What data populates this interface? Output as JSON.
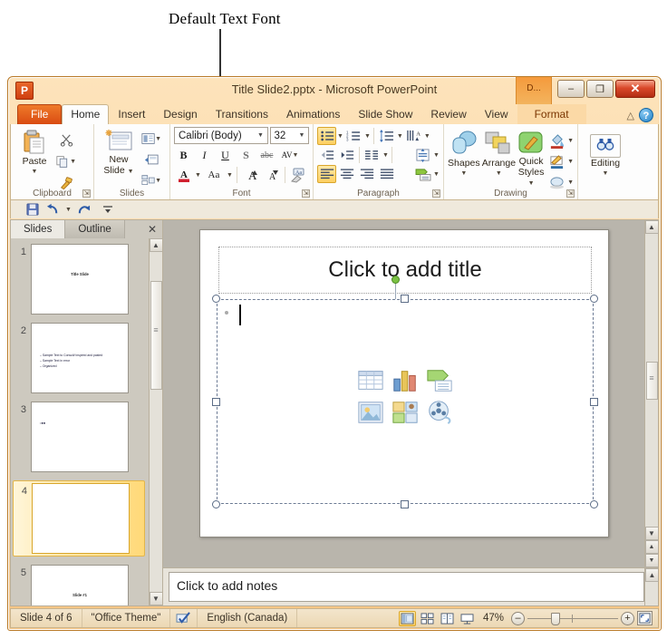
{
  "annotation": {
    "label": "Default Text Font"
  },
  "window": {
    "title": "Title Slide2.pptx  -  Microsoft PowerPoint",
    "app_logo": "P",
    "contextual_tab_short": "D...",
    "controls": {
      "minimize": "–",
      "restore": "❐",
      "close": "✕"
    }
  },
  "ribbon": {
    "tabs": [
      {
        "label": "File",
        "state": "file"
      },
      {
        "label": "Home",
        "state": "active"
      },
      {
        "label": "Insert",
        "state": "normal"
      },
      {
        "label": "Design",
        "state": "normal"
      },
      {
        "label": "Transitions",
        "state": "normal"
      },
      {
        "label": "Animations",
        "state": "normal"
      },
      {
        "label": "Slide Show",
        "state": "normal"
      },
      {
        "label": "Review",
        "state": "normal"
      },
      {
        "label": "View",
        "state": "normal"
      },
      {
        "label": "Format",
        "state": "contextual"
      }
    ],
    "minimize_ribbon_icon": "minimize-ribbon-icon",
    "help_icon": "help-icon",
    "help_label": "?",
    "groups": {
      "clipboard": {
        "label": "Clipboard",
        "paste_label": "Paste",
        "cut_icon": "scissors-icon",
        "copy_icon": "copy-icon",
        "format_painter_icon": "format-painter-icon",
        "dialog_launcher": "dialog-launcher-icon"
      },
      "slides": {
        "label": "Slides",
        "new_slide_label": "New\nSlide",
        "layout_icon": "slide-layout-icon",
        "reset_icon": "slide-reset-icon",
        "section_icon": "slide-section-icon"
      },
      "font": {
        "label": "Font",
        "font_name": "Calibri (Body)",
        "font_size": "32",
        "bold": "B",
        "italic": "I",
        "underline": "U",
        "shadow": "S",
        "strikethrough": "abc",
        "character_spacing": "AV",
        "font_color": "A",
        "change_case": "Aa",
        "grow_font": "A",
        "shrink_font": "A",
        "clear_formatting_icon": "clear-formatting-icon",
        "dialog_launcher": "dialog-launcher-icon"
      },
      "paragraph": {
        "label": "Paragraph",
        "bullets_icon": "bullets-icon",
        "numbering_icon": "numbering-icon",
        "line_spacing_icon": "line-spacing-icon",
        "text_direction_icon": "text-direction-icon",
        "decrease_indent_icon": "decrease-indent-icon",
        "increase_indent_icon": "increase-indent-icon",
        "columns_icon": "columns-icon",
        "align_text_icon": "align-text-icon",
        "align_left_icon": "align-left-icon",
        "align_center_icon": "align-center-icon",
        "align_right_icon": "align-right-icon",
        "justify_icon": "justify-icon",
        "smartart_icon": "convert-to-smartart-icon",
        "dialog_launcher": "dialog-launcher-icon"
      },
      "drawing": {
        "label": "Drawing",
        "shapes_label": "Shapes",
        "arrange_label": "Arrange",
        "quick_styles_label": "Quick\nStyles",
        "shape_fill_icon": "shape-fill-icon",
        "shape_outline_icon": "shape-outline-icon",
        "shape_effects_icon": "shape-effects-icon",
        "dialog_launcher": "dialog-launcher-icon"
      },
      "editing": {
        "label": "Editing",
        "editing_label": "Editing",
        "find_icon": "find-binoculars-icon"
      }
    }
  },
  "quick_access": {
    "save_icon": "save-icon",
    "undo_icon": "undo-icon",
    "redo_icon": "redo-icon",
    "customize_icon": "customize-qat-icon"
  },
  "slides_panel": {
    "tabs": [
      {
        "label": "Slides",
        "active": true
      },
      {
        "label": "Outline",
        "active": false
      }
    ],
    "close_label": "✕",
    "thumbnails": [
      {
        "number": "1",
        "kind": "title",
        "text": "Title Slide",
        "selected": false
      },
      {
        "number": "2",
        "kind": "bullets",
        "lines": [
          "Sample Text to Consult/ inspired and pasted",
          "Sample Text in error",
          "Organized"
        ],
        "selected": false
      },
      {
        "number": "3",
        "kind": "small",
        "text": ":●●",
        "selected": false
      },
      {
        "number": "4",
        "kind": "blank",
        "text": "",
        "selected": true
      },
      {
        "number": "5",
        "kind": "title",
        "text": "Slide #1",
        "selected": false
      }
    ],
    "scroll_up": "▲",
    "scroll_down": "▼"
  },
  "slide_editor": {
    "title_placeholder": "Click to add title",
    "content_placeholder_icons": [
      "insert-table-icon",
      "insert-chart-icon",
      "insert-smartart-icon",
      "insert-picture-icon",
      "insert-clipart-icon",
      "insert-media-clip-icon"
    ],
    "scroll_up": "▲",
    "scroll_down": "▼",
    "previous_slide": "▲",
    "next_slide": "▼"
  },
  "notes": {
    "placeholder": "Click to add notes"
  },
  "status_bar": {
    "slide_counter": "Slide 4 of 6",
    "theme": "\"Office Theme\"",
    "spellcheck_icon": "spellcheck-icon",
    "language": "English (Canada)",
    "views": [
      {
        "name": "normal-view",
        "icon": "normal-view-icon",
        "active": true
      },
      {
        "name": "slide-sorter-view",
        "icon": "slide-sorter-icon",
        "active": false
      },
      {
        "name": "reading-view",
        "icon": "reading-view-icon",
        "active": false
      },
      {
        "name": "slide-show-view",
        "icon": "slide-show-icon",
        "active": false
      }
    ],
    "zoom_level": "47%",
    "zoom_out": "–",
    "zoom_in": "+",
    "fit_to_window_icon": "fit-to-window-icon"
  },
  "colors": {
    "accent_orange": "#e8682a",
    "ribbon_bg": "#fdfdfd",
    "frame": "#f7c583",
    "selection_green": "#7ac143",
    "highlight_yellow": "#ffd062"
  }
}
